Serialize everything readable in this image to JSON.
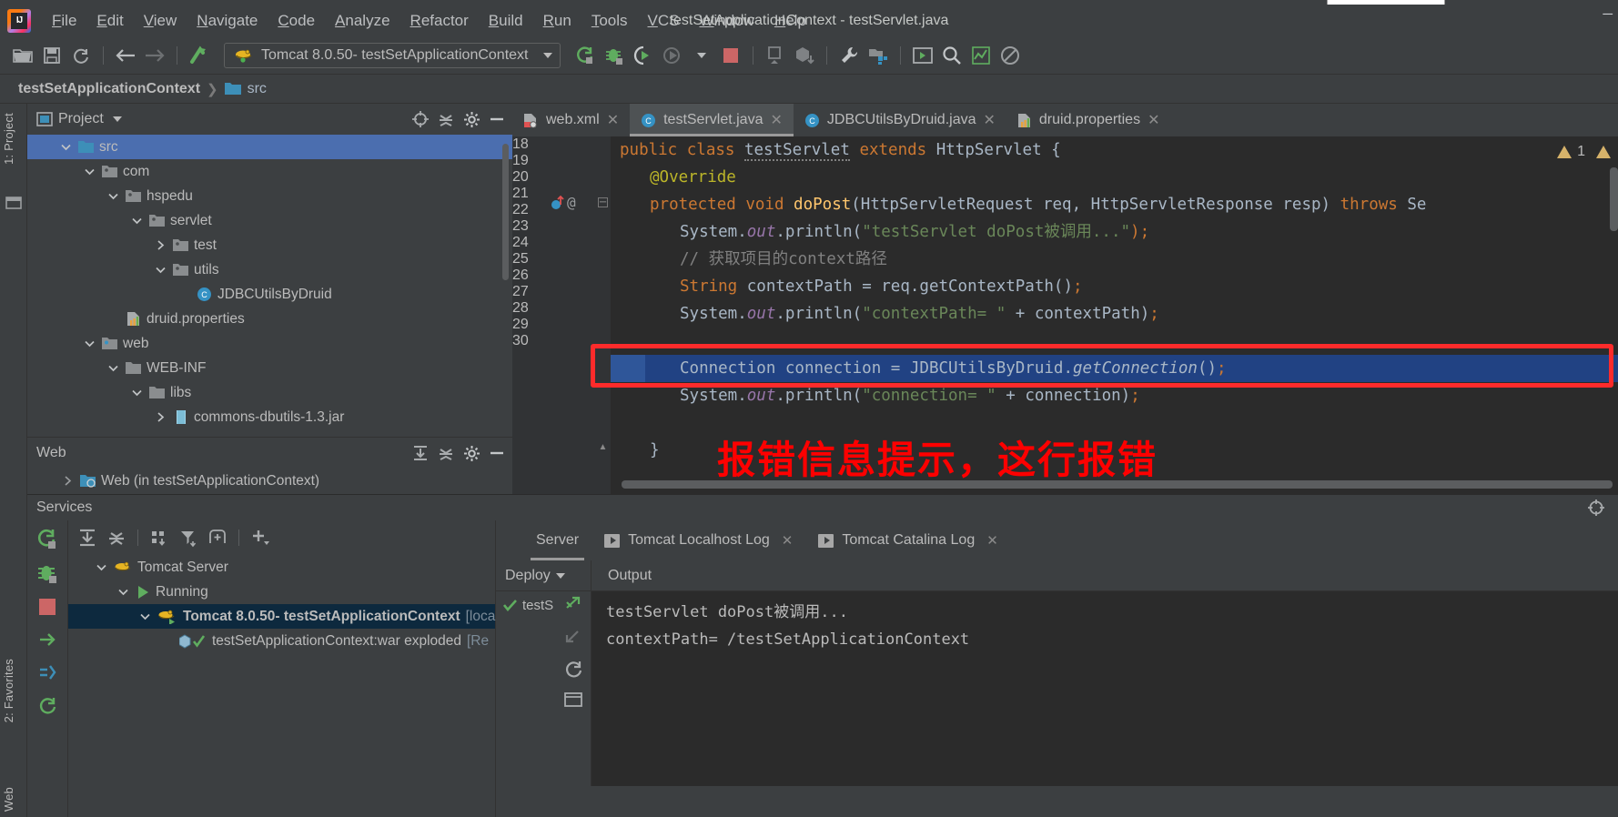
{
  "window": {
    "title": "testSetApplicationContext - testServlet.java"
  },
  "menubar": {
    "items": [
      "File",
      "Edit",
      "View",
      "Navigate",
      "Code",
      "Analyze",
      "Refactor",
      "Build",
      "Run",
      "Tools",
      "VCS",
      "Window",
      "Help"
    ]
  },
  "toolbar": {
    "run_config": "Tomcat 8.0.50- testSetApplicationContext",
    "icons": [
      "open-folder-icon",
      "save-icon",
      "sync-icon",
      "back-arrow-icon",
      "forward-arrow-icon",
      "update-project-icon",
      "rerun-icon",
      "debug-icon",
      "run-with-coverage-icon",
      "profile-icon",
      "stop-icon",
      "build-icon",
      "build-artifact-icon",
      "settings-wrench-icon",
      "project-structure-icon",
      "terminal-icon",
      "search-everywhere-icon",
      "analyze-icon",
      "disable-icon"
    ]
  },
  "breadcrumb": {
    "project": "testSetApplicationContext",
    "folder": "src"
  },
  "left_strip": {
    "project_tab": "1: Project",
    "favorites_tab": "2: Favorites",
    "web_tab": "Web"
  },
  "project_panel": {
    "title": "Project",
    "tree": [
      {
        "label": "src",
        "indent": 1,
        "twisty": "down",
        "icon": "source-folder-icon",
        "selected": true
      },
      {
        "label": "com",
        "indent": 2,
        "twisty": "down",
        "icon": "package-icon"
      },
      {
        "label": "hspedu",
        "indent": 3,
        "twisty": "down",
        "icon": "package-icon"
      },
      {
        "label": "servlet",
        "indent": 4,
        "twisty": "down",
        "icon": "package-icon"
      },
      {
        "label": "test",
        "indent": 5,
        "twisty": "right",
        "icon": "package-icon"
      },
      {
        "label": "utils",
        "indent": 5,
        "twisty": "down",
        "icon": "package-icon"
      },
      {
        "label": "JDBCUtilsByDruid",
        "indent": 6,
        "twisty": "none",
        "icon": "java-class-icon"
      },
      {
        "label": "druid.properties",
        "indent": 3,
        "twisty": "none",
        "icon": "properties-file-icon"
      },
      {
        "label": "web",
        "indent": 2,
        "twisty": "down",
        "icon": "web-folder-icon"
      },
      {
        "label": "WEB-INF",
        "indent": 3,
        "twisty": "down",
        "icon": "folder-icon"
      },
      {
        "label": "libs",
        "indent": 4,
        "twisty": "down",
        "icon": "folder-icon"
      },
      {
        "label": "commons-dbutils-1.3.jar",
        "indent": 5,
        "twisty": "right",
        "icon": "jar-icon"
      }
    ],
    "header_icons": [
      "locate-icon",
      "collapse-all-icon",
      "gear-icon",
      "hide-icon"
    ]
  },
  "web_panel": {
    "title": "Web",
    "item": "Web (in testSetApplicationContext)",
    "header_icons": [
      "expand-all-icon",
      "collapse-all-icon",
      "gear-icon",
      "hide-icon"
    ]
  },
  "editor": {
    "tabs": [
      {
        "label": "web.xml",
        "icon": "xml-file-icon",
        "active": false
      },
      {
        "label": "testServlet.java",
        "icon": "java-class-icon",
        "active": true
      },
      {
        "label": "JDBCUtilsByDruid.java",
        "icon": "java-class-icon",
        "active": false
      },
      {
        "label": "druid.properties",
        "icon": "properties-file-icon",
        "active": false
      }
    ],
    "warning_count": "1",
    "line_numbers": [
      "18",
      "19",
      "20",
      "21",
      "22",
      "23",
      "24",
      "25",
      "26",
      "27",
      "28",
      "29",
      "30"
    ],
    "lines": [
      {
        "n": "18",
        "indent": 0,
        "tokens": [
          {
            "t": "public ",
            "c": "kw"
          },
          {
            "t": "class ",
            "c": "kw"
          },
          {
            "t": "testServlet",
            "c": "cls-underline"
          },
          {
            "t": " ",
            "c": "id"
          },
          {
            "t": "extends ",
            "c": "kw"
          },
          {
            "t": "HttpServlet {",
            "c": "id"
          }
        ]
      },
      {
        "n": "19",
        "indent": 1,
        "tokens": [
          {
            "t": "@Override",
            "c": "anno"
          }
        ]
      },
      {
        "n": "20",
        "indent": 1,
        "tokens": [
          {
            "t": "protected ",
            "c": "kw"
          },
          {
            "t": "void ",
            "c": "kw"
          },
          {
            "t": "doPost",
            "c": "mth"
          },
          {
            "t": "(HttpServletRequest req, HttpServletResponse resp) ",
            "c": "id"
          },
          {
            "t": "throws ",
            "c": "kw"
          },
          {
            "t": "Se",
            "c": "id"
          }
        ]
      },
      {
        "n": "21",
        "indent": 2,
        "tokens": [
          {
            "t": "System.",
            "c": "id"
          },
          {
            "t": "out",
            "c": "fld"
          },
          {
            "t": ".println(",
            "c": "id"
          },
          {
            "t": "\"testServlet doPost被调用...\"",
            "c": "str"
          },
          {
            "t": ");",
            "c": "semi"
          }
        ]
      },
      {
        "n": "22",
        "indent": 2,
        "tokens": [
          {
            "t": "// 获取项目的context路径",
            "c": "cmt"
          }
        ]
      },
      {
        "n": "23",
        "indent": 2,
        "tokens": [
          {
            "t": "String",
            "c": "kw"
          },
          {
            "t": " contextPath ",
            "c": "id"
          },
          {
            "t": "= ",
            "c": "id"
          },
          {
            "t": "req.getContextPath()",
            "c": "id"
          },
          {
            "t": ";",
            "c": "semi"
          }
        ]
      },
      {
        "n": "24",
        "indent": 2,
        "tokens": [
          {
            "t": "System.",
            "c": "id"
          },
          {
            "t": "out",
            "c": "fld"
          },
          {
            "t": ".println(",
            "c": "id"
          },
          {
            "t": "\"contextPath= \"",
            "c": "str"
          },
          {
            "t": " + contextPath)",
            "c": "id"
          },
          {
            "t": ";",
            "c": "semi"
          }
        ]
      },
      {
        "n": "25",
        "indent": 0,
        "tokens": []
      },
      {
        "n": "26",
        "indent": 2,
        "selected": true,
        "tokens": [
          {
            "t": "Connection connection ",
            "c": "id"
          },
          {
            "t": "= ",
            "c": "id"
          },
          {
            "t": "JDBCUtilsByDruid.",
            "c": "id"
          },
          {
            "t": "getConnection",
            "c": "mth-italic"
          },
          {
            "t": "()",
            "c": "id"
          },
          {
            "t": ";",
            "c": "semi"
          }
        ]
      },
      {
        "n": "27",
        "indent": 2,
        "tokens": [
          {
            "t": "System.",
            "c": "id"
          },
          {
            "t": "out",
            "c": "fld"
          },
          {
            "t": ".println(",
            "c": "id"
          },
          {
            "t": "\"connection= \"",
            "c": "str"
          },
          {
            "t": " + connection)",
            "c": "id"
          },
          {
            "t": ";",
            "c": "semi"
          }
        ]
      },
      {
        "n": "28",
        "indent": 0,
        "tokens": []
      },
      {
        "n": "29",
        "indent": 1,
        "tokens": [
          {
            "t": "}",
            "c": "id"
          }
        ]
      },
      {
        "n": "30",
        "indent": 0,
        "tokens": []
      }
    ],
    "annotation_text": "报错信息提示，这行报错"
  },
  "services": {
    "title": "Services",
    "rail_icons": [
      "rerun-icon",
      "debug-icon",
      "stop-icon",
      "redeploy-icon",
      "restart-icon"
    ],
    "toolbar_icons": [
      "expand-all-icon",
      "collapse-all-icon",
      "group-icon",
      "filter-icon",
      "add-frame-icon",
      "add-icon"
    ],
    "tree": [
      {
        "label": "Tomcat Server",
        "indent": 1,
        "twisty": "down",
        "icon": "tomcat-icon"
      },
      {
        "label": "Running",
        "indent": 2,
        "twisty": "down",
        "icon": "run-green-icon"
      },
      {
        "label": "Tomcat 8.0.50- testSetApplicationContext",
        "suffix": " [local]",
        "indent": 3,
        "twisty": "down",
        "icon": "tomcat-run-icon",
        "selected": true
      },
      {
        "label": "testSetApplicationContext:war exploded",
        "suffix": " [Re",
        "indent": 4,
        "twisty": "none",
        "icon": "artifact-ok-icon"
      }
    ],
    "log_tabs": [
      {
        "label": "Server",
        "active": true,
        "closable": false,
        "icon": ""
      },
      {
        "label": "Tomcat Localhost Log",
        "active": false,
        "closable": true,
        "icon": "play-badge"
      },
      {
        "label": "Tomcat Catalina Log",
        "active": false,
        "closable": true,
        "icon": "play-badge"
      }
    ],
    "deploy_label": "Deploy",
    "output_label": "Output",
    "deploy_items": [
      {
        "label": "testS",
        "status": "ok"
      }
    ],
    "deploy_side_icons": [
      "deploy-arrow-icon",
      "undeploy-icon",
      "refresh-icon",
      "console-icon"
    ],
    "console_lines": [
      "testServlet doPost被调用...",
      "contextPath= /testSetApplicationContext"
    ]
  },
  "colors": {
    "bg_panel": "#3c3f41",
    "bg_editor": "#2b2b2b",
    "accent_selection": "#214283",
    "tree_selection": "#4b6eaf",
    "annotation_red": "#fe0000",
    "keyword_orange": "#cc7832",
    "string_green": "#6a8759",
    "comment_gray": "#808080",
    "field_purple": "#9876aa",
    "method_yellow": "#ffc66d",
    "annotation_yellow": "#bbb529",
    "green_run": "#5ba85b"
  }
}
